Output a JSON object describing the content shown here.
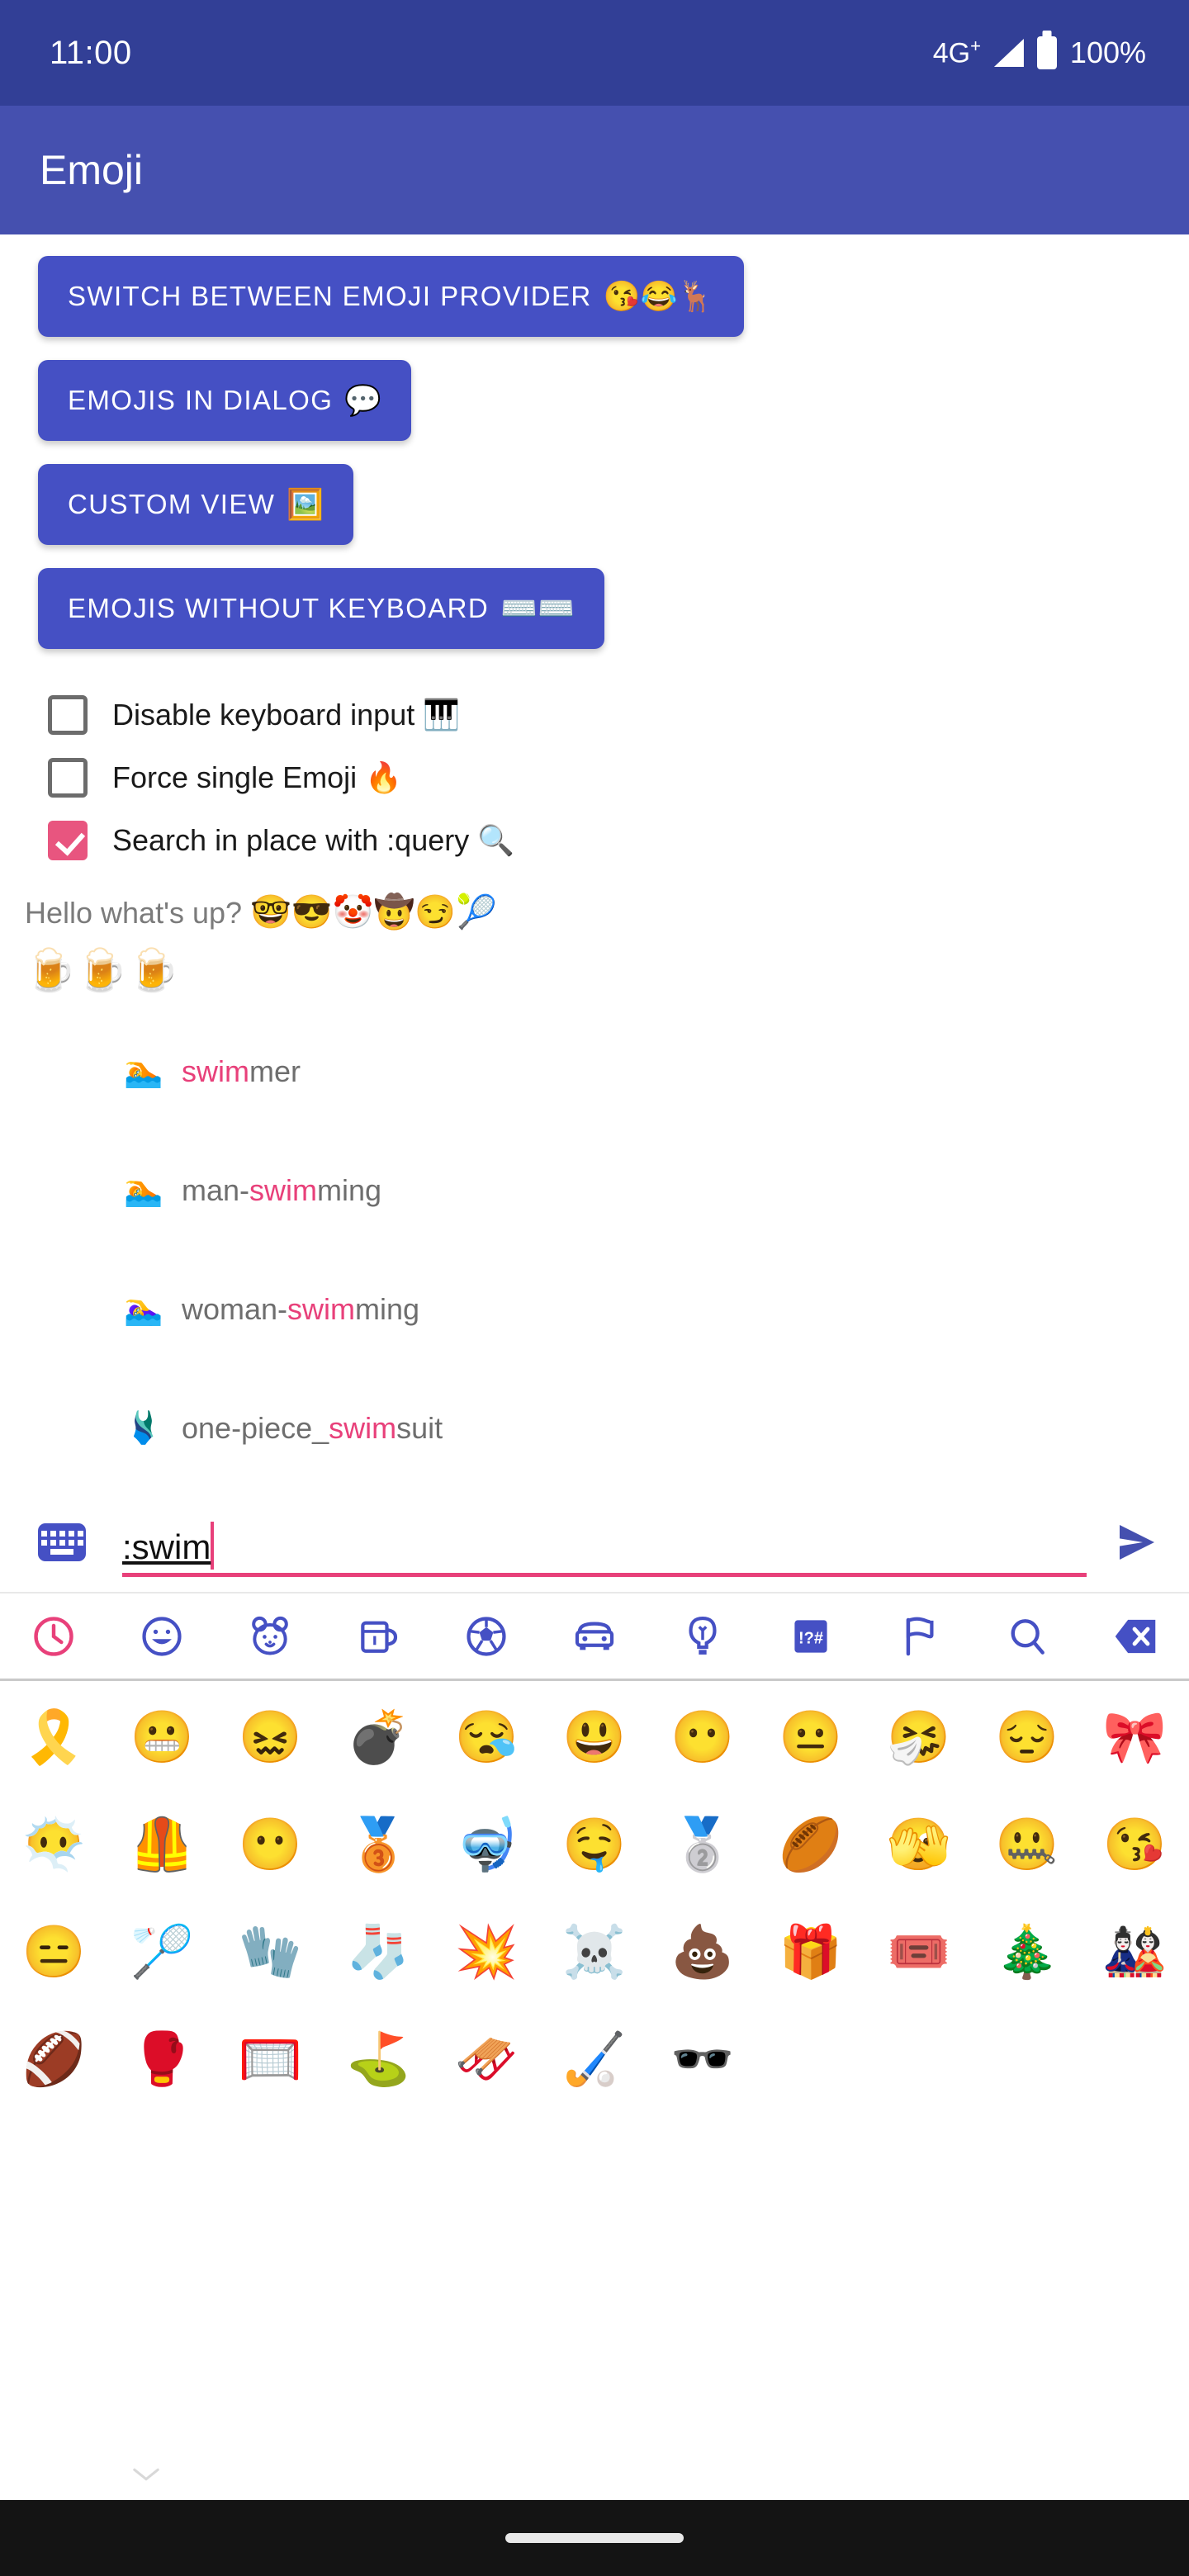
{
  "status_bar": {
    "time": "11:00",
    "network": "4G",
    "network_sup": "+",
    "battery_percent": "100%",
    "bg_color": "#323F96"
  },
  "app_bar": {
    "title": "Emoji",
    "bg_color": "#4550AF"
  },
  "theme": {
    "primary": "#4550C4",
    "accent_pink": "#E8407A",
    "checkbox_checked": "#E8557F",
    "muted_text": "#7b7b7b"
  },
  "buttons": [
    {
      "label": "SWITCH BETWEEN EMOJI PROVIDER",
      "emoji": "😘😂🦌"
    },
    {
      "label": "EMOJIS IN DIALOG",
      "emoji": "💬"
    },
    {
      "label": "CUSTOM VIEW",
      "emoji": "🖼️"
    },
    {
      "label": "EMOJIS WITHOUT KEYBOARD",
      "emoji": "⌨️⌨️"
    }
  ],
  "checkboxes": [
    {
      "label": "Disable keyboard input",
      "emoji": "🎹",
      "checked": false
    },
    {
      "label": "Force single Emoji",
      "emoji": "🔥",
      "checked": false
    },
    {
      "label": "Search in place with :query",
      "emoji": "🔍",
      "checked": true
    }
  ],
  "preview": {
    "line1_text": "Hello what's up? ",
    "line1_emoji": "🤓😎🤡🤠😏🎾",
    "line2_emoji": "🍺🍺🍺"
  },
  "suggestions": [
    {
      "emoji": "🏊",
      "pre": "",
      "match": "swim",
      "post": "mer"
    },
    {
      "emoji": "🏊",
      "pre": "man-",
      "match": "swim",
      "post": "ming"
    },
    {
      "emoji": "🏊‍♀️",
      "pre": "woman-",
      "match": "swim",
      "post": "ming"
    },
    {
      "emoji": "🩱",
      "pre": "one-piece_",
      "match": "swim",
      "post": "suit"
    }
  ],
  "input": {
    "value": ":swim",
    "placeholder": "",
    "keyboard_icon": "keyboard-icon",
    "send_icon": "send-icon"
  },
  "category_tabs": [
    {
      "name": "recent",
      "icon": "clock-icon",
      "selected": true
    },
    {
      "name": "smileys",
      "icon": "smiley-icon",
      "selected": false
    },
    {
      "name": "animals",
      "icon": "animal-face-icon",
      "selected": false
    },
    {
      "name": "food",
      "icon": "cup-icon",
      "selected": false
    },
    {
      "name": "activity",
      "icon": "soccer-ball-icon",
      "selected": false
    },
    {
      "name": "travel",
      "icon": "car-icon",
      "selected": false
    },
    {
      "name": "objects",
      "icon": "lightbulb-icon",
      "selected": false
    },
    {
      "name": "symbols",
      "icon": "punctuation-icon",
      "selected": false
    },
    {
      "name": "flags",
      "icon": "flag-icon",
      "selected": false
    },
    {
      "name": "search",
      "icon": "search-icon",
      "selected": false
    },
    {
      "name": "backspace",
      "icon": "backspace-icon",
      "selected": false
    }
  ],
  "emoji_grid": {
    "columns": 11,
    "rows": [
      [
        "🎗️",
        "😬",
        "😖",
        "💣",
        "😪",
        "😃",
        "😶",
        "😐",
        "🤧",
        "😔",
        "🎀"
      ],
      [
        "😶‍🌫️",
        "🦺",
        "😶",
        "🥉",
        "🤿",
        "🤤",
        "🥈",
        "🏉",
        "🫣",
        "🤐",
        "😘"
      ],
      [
        "😑",
        "🏸",
        "🧤",
        "🧦",
        "💥",
        "☠️",
        "💩",
        "🎁",
        "🎟️",
        "🎄",
        "🎎"
      ],
      [
        "🏈",
        "🥊",
        "🥅",
        "⛳",
        "🛷",
        "🏑",
        "🕶️"
      ]
    ]
  },
  "bottom": {
    "collapse_icon": "chevron-down-icon",
    "gesture_pill": "home-indicator"
  }
}
